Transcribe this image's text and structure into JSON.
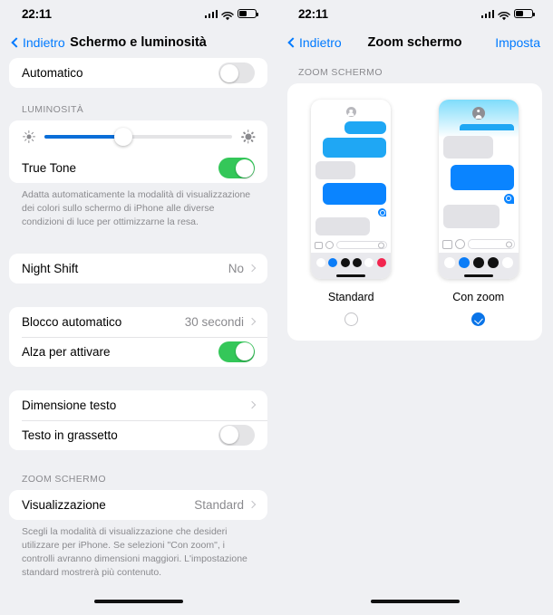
{
  "left_screen": {
    "status_bar": {
      "time": "22:11",
      "signal_icon": "cellular-bars-icon",
      "wifi_icon": "wifi-icon",
      "battery_icon": "battery-icon"
    },
    "nav": {
      "back_label": "Indietro",
      "title": "Schermo e luminosità"
    },
    "rows": {
      "automatico": {
        "label": "Automatico",
        "toggle": "off"
      },
      "brightness_header": "LUMINOSITÀ",
      "brightness_value_percent": 42,
      "true_tone": {
        "label": "True Tone",
        "toggle": "on"
      },
      "true_tone_footnote": "Adatta automaticamente la modalità di visualizzazione dei colori sullo schermo di iPhone alle diverse condizioni di luce per ottimizzarne la resa.",
      "night_shift": {
        "label": "Night Shift",
        "value": "No"
      },
      "blocco_automatico": {
        "label": "Blocco automatico",
        "value": "30 secondi"
      },
      "alza_per_attivare": {
        "label": "Alza per attivare",
        "toggle": "on"
      },
      "dimensione_testo": {
        "label": "Dimensione testo",
        "value": ""
      },
      "testo_in_grassetto": {
        "label": "Testo in grassetto",
        "toggle": "off"
      },
      "zoom_header": "ZOOM SCHERMO",
      "visualizzazione": {
        "label": "Visualizzazione",
        "value": "Standard"
      },
      "zoom_footnote": "Scegli la modalità di visualizzazione che desideri utilizzare per iPhone. Se selezioni \"Con zoom\", i controlli avranno dimensioni maggiori. L'impostazione standard mostrerà più contenuto."
    }
  },
  "right_screen": {
    "status_bar": {
      "time": "22:11",
      "signal_icon": "cellular-bars-icon",
      "wifi_icon": "wifi-icon",
      "battery_icon": "battery-icon"
    },
    "nav": {
      "back_label": "Indietro",
      "title": "Zoom schermo",
      "action_label": "Imposta"
    },
    "section_header": "ZOOM SCHERMO",
    "options": [
      {
        "label": "Standard",
        "selected": false
      },
      {
        "label": "Con zoom",
        "selected": true
      }
    ]
  },
  "colors": {
    "accent_blue": "#007aff",
    "selected_blue": "#0a74e8",
    "toggle_green": "#34c759",
    "slider_blue": "#0a6ed8",
    "bubble_blue": "#1fa7f4",
    "bubble_blue_dark": "#0a84ff",
    "bubble_grey": "#e2e2e6",
    "page_background": "#eff0f3",
    "card_background": "#ffffff",
    "secondary_text": "#8a8a8e"
  }
}
